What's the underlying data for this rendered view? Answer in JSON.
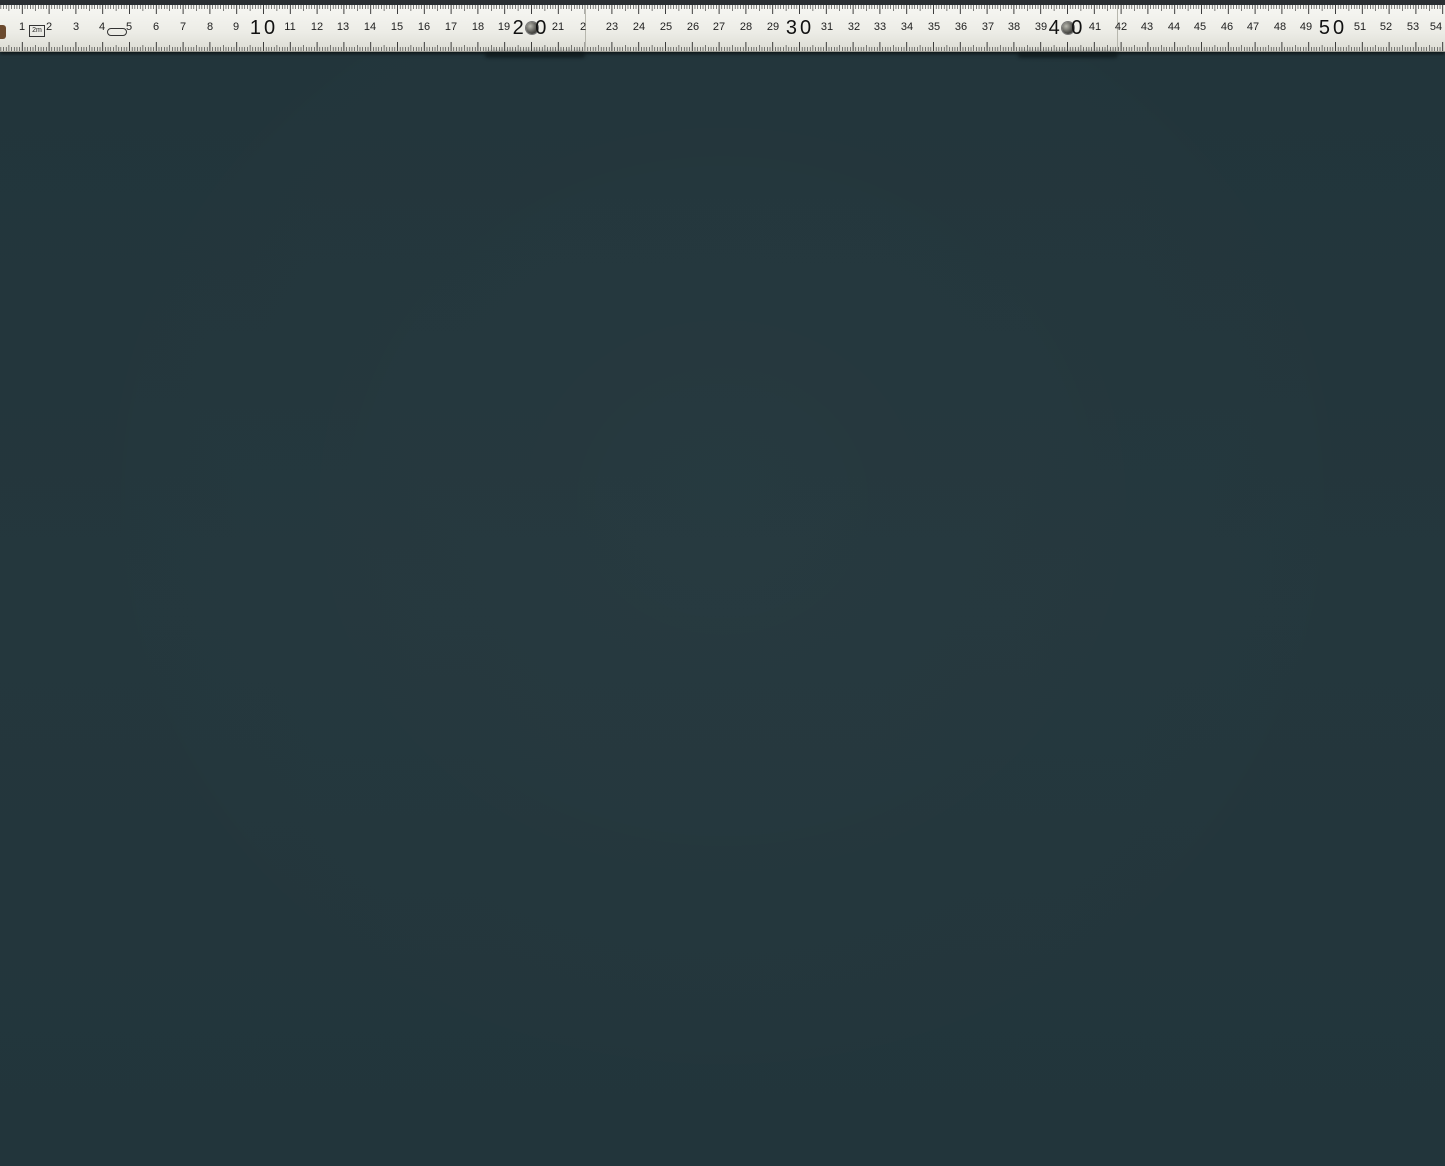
{
  "image": {
    "description_type": "photograph",
    "background_color": "#23363c",
    "ruler_color": "#f1f1ec",
    "ink_color": "#1e1e1e"
  },
  "ruler": {
    "minor_labels": [
      "1",
      "2",
      "3",
      "4",
      "5",
      "6",
      "7",
      "8",
      "9",
      "11",
      "12",
      "13",
      "14",
      "15",
      "16",
      "17",
      "18",
      "19",
      "21",
      "2",
      "23",
      "24",
      "25",
      "26",
      "27",
      "28",
      "29",
      "31",
      "32",
      "33",
      "34",
      "35",
      "36",
      "37",
      "38",
      "39",
      "41",
      "42",
      "43",
      "44",
      "45",
      "46",
      "47",
      "48",
      "49",
      "51",
      "52",
      "53",
      "54"
    ],
    "major_labels": [
      "10",
      "2 0",
      "30",
      "4 0",
      "50"
    ],
    "logo_text": "2m"
  }
}
